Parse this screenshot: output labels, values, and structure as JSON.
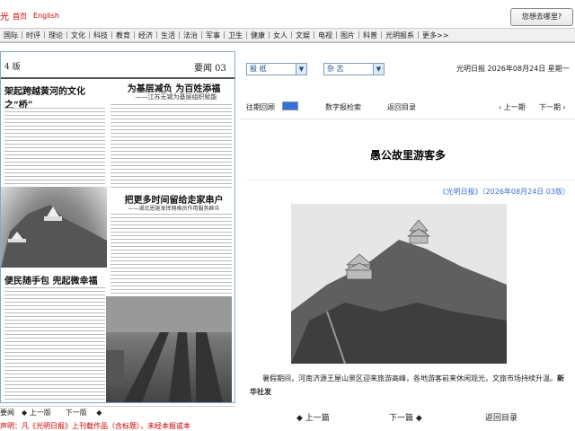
{
  "header": {
    "home": "首页",
    "english": "English",
    "search_label": "您想去哪里?"
  },
  "nav": [
    "国际",
    "时评",
    "理论",
    "文化",
    "科技",
    "教育",
    "经济",
    "生活",
    "法治",
    "军事",
    "卫生",
    "健康",
    "女人",
    "文娱",
    "电视",
    "图片",
    "科普",
    "光明报系",
    "更多>>"
  ],
  "newspaper": {
    "page_label_left": "4 版",
    "page_label_right": "要闻 03",
    "headline_left": "架起跨越黄河的文化之“桥”",
    "headline_right_top": "为基层减负  为百姓添福",
    "sub_right_top": "——江苏无锡为基层组织赋能",
    "headline_mid": "把更多时间留给走家串户",
    "sub_mid": "——湖北恩施发挥网格员作用服务群众",
    "headline_bottom": "便民随手包  兜起微幸福"
  },
  "viewer": {
    "bottom_label": "要闻",
    "prev_page": "上一版",
    "next_page": "下一版",
    "red_notice": "声明：凡《光明日报》上刊载作品（含标题），未经本报或本"
  },
  "filters": {
    "newspaper": "报 纸",
    "magazine": "杂 志",
    "date_text": "光明日报  2026年08月24日  星期一"
  },
  "controls": {
    "prev_issue": "往期回顾",
    "digital": "数字报检索",
    "back_dir": "返回目录",
    "prev_page": "上一期",
    "next_page": "下一期"
  },
  "article": {
    "title": "愚公故里游客多",
    "source": "《光明日报》（2026年08月24日  03版）",
    "caption_main": "暑假期间，河南济源王屋山景区迎来旅游高峰，各地游客前来休闲观光，文旅市场持续升温。",
    "caption_credit": "新华社发"
  },
  "pagination": {
    "prev": "上一篇",
    "next": "下一篇",
    "back": "返回目录"
  }
}
